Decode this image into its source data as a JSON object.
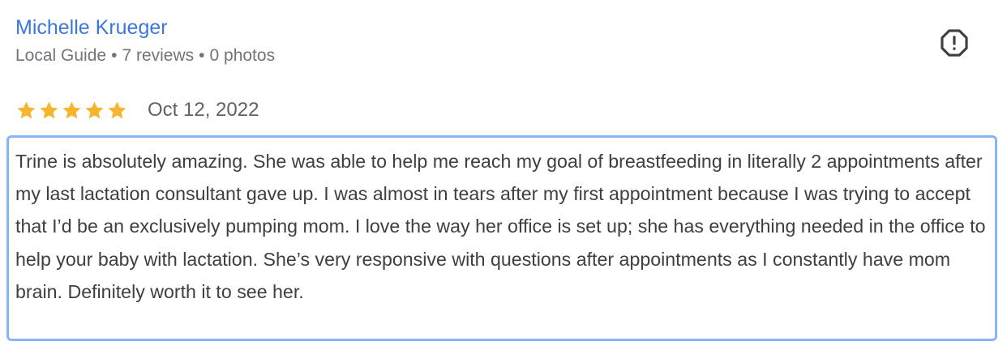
{
  "reviewer": {
    "name": "Michelle Krueger",
    "badge": "Local Guide",
    "reviews": "7 reviews",
    "photos": "0 photos",
    "separator": "•"
  },
  "actions": {
    "flag_icon": "report-flag-icon"
  },
  "review": {
    "rating": 5,
    "rating_max": 5,
    "date": "Oct 12, 2022",
    "text": "Trine is absolutely amazing. She was able to help me reach my goal of breastfeeding in literally 2 appointments after my last lactation consultant gave up. I was almost in tears after my first appointment because I was trying to accept that I’d be an exclusively pumping mom. I love the way her office is set up; she has everything needed in the office to help your baby with lactation. She’s very responsive with questions after appointments as I constantly have mom brain. Definitely worth it to see her."
  },
  "colors": {
    "name_link": "#3b78d8",
    "star_fill": "#f5b52e",
    "star_empty": "#dadce0",
    "focus_border": "#8ab4f8",
    "secondary_text": "#70757a",
    "body_text": "#3c4043"
  }
}
